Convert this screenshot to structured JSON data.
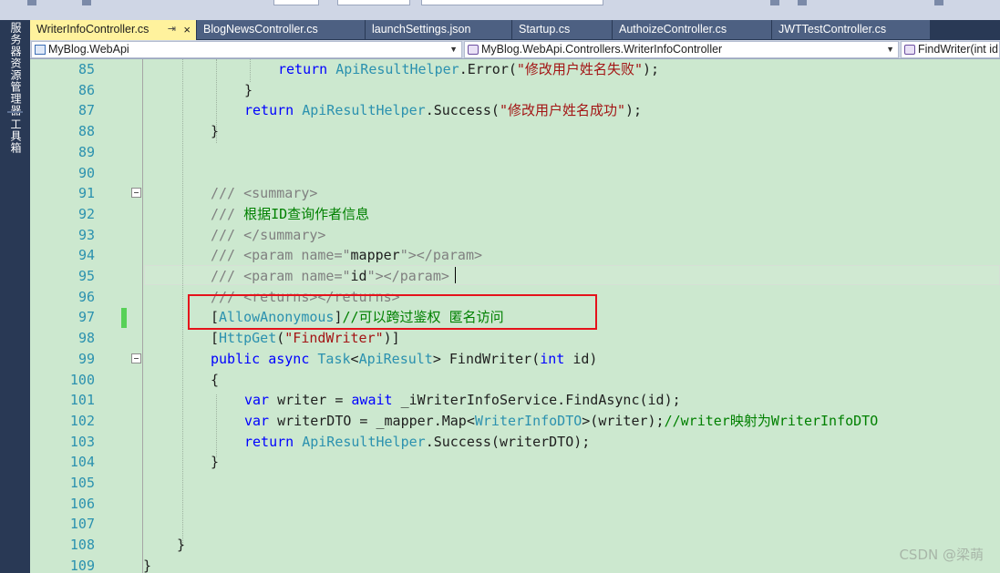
{
  "side_panel": {
    "items": [
      "服务器资源管理器",
      "工具箱"
    ]
  },
  "tabs": [
    {
      "label": "WriterInfoController.cs",
      "active": true,
      "pin": "⇥",
      "close": "×"
    },
    {
      "label": "BlogNewsController.cs",
      "active": false
    },
    {
      "label": "launchSettings.json",
      "active": false
    },
    {
      "label": "Startup.cs",
      "active": false
    },
    {
      "label": "AuthoizeController.cs",
      "active": false
    },
    {
      "label": "JWTTestController.cs",
      "active": false
    }
  ],
  "navbar": {
    "project": "MyBlog.WebApi",
    "class": "MyBlog.WebApi.Controllers.WriterInfoController",
    "member": "FindWriter(int id"
  },
  "editor": {
    "line_numbers": [
      "85",
      "86",
      "87",
      "88",
      "89",
      "90",
      "91",
      "92",
      "93",
      "94",
      "95",
      "96",
      "97",
      "98",
      "99",
      "100",
      "101",
      "102",
      "103",
      "104",
      "105",
      "106",
      "107",
      "108",
      "109"
    ],
    "lines": [
      [
        [
          "kw",
          "return"
        ],
        [
          "tx",
          " "
        ],
        [
          "ty",
          "ApiResultHelper"
        ],
        [
          "tx",
          ".Error("
        ],
        [
          "str",
          "\"修改用户姓名失败\""
        ],
        [
          "tx",
          ");"
        ]
      ],
      [
        [
          "tx",
          "}"
        ]
      ],
      [
        [
          "kw",
          "return"
        ],
        [
          "tx",
          " "
        ],
        [
          "ty",
          "ApiResultHelper"
        ],
        [
          "tx",
          ".Success("
        ],
        [
          "str",
          "\"修改用户姓名成功\""
        ],
        [
          "tx",
          ");"
        ]
      ],
      [
        [
          "tx",
          "}"
        ]
      ],
      [],
      [],
      [
        [
          "xml",
          "/// <summary>"
        ]
      ],
      [
        [
          "xml",
          "/// "
        ],
        [
          "cm",
          "根据ID查询作者信息"
        ]
      ],
      [
        [
          "xml",
          "/// </summary>"
        ]
      ],
      [
        [
          "xml",
          "/// <param name=\""
        ],
        [
          "nm",
          "mapper"
        ],
        [
          "xml",
          "\"></param>"
        ]
      ],
      [
        [
          "xml",
          "/// <param name=\""
        ],
        [
          "nm",
          "id"
        ],
        [
          "xml",
          "\"></param>"
        ]
      ],
      [
        [
          "xml",
          "/// <returns></returns>"
        ]
      ],
      [
        [
          "tx",
          "["
        ],
        [
          "ty",
          "AllowAnonymous"
        ],
        [
          "tx",
          "]"
        ],
        [
          "cm",
          "//可以跨过鉴权 匿名访问"
        ]
      ],
      [
        [
          "tx",
          "["
        ],
        [
          "ty",
          "HttpGet"
        ],
        [
          "tx",
          "("
        ],
        [
          "str",
          "\"FindWriter\""
        ],
        [
          "tx",
          ")]"
        ]
      ],
      [
        [
          "kw",
          "public"
        ],
        [
          "tx",
          " "
        ],
        [
          "kw",
          "async"
        ],
        [
          "tx",
          " "
        ],
        [
          "ty",
          "Task"
        ],
        [
          "tx",
          "<"
        ],
        [
          "ty",
          "ApiResult"
        ],
        [
          "tx",
          "> FindWriter("
        ],
        [
          "kw",
          "int"
        ],
        [
          "tx",
          " id)"
        ]
      ],
      [
        [
          "tx",
          "{"
        ]
      ],
      [
        [
          "kw",
          "var"
        ],
        [
          "tx",
          " writer = "
        ],
        [
          "kw",
          "await"
        ],
        [
          "tx",
          " _iWriterInfoService.FindAsync(id);"
        ]
      ],
      [
        [
          "kw",
          "var"
        ],
        [
          "tx",
          " writerDTO = _mapper.Map<"
        ],
        [
          "ty",
          "WriterInfoDTO"
        ],
        [
          "tx",
          ">(writer);"
        ],
        [
          "cm",
          "//writer映射为WriterInfoDTO"
        ]
      ],
      [
        [
          "kw",
          "return"
        ],
        [
          "tx",
          " "
        ],
        [
          "ty",
          "ApiResultHelper"
        ],
        [
          "tx",
          ".Success(writerDTO);"
        ]
      ],
      [
        [
          "tx",
          "}"
        ]
      ],
      [],
      [],
      [],
      [
        [
          "tx",
          "}"
        ]
      ],
      [
        [
          "tx",
          "}"
        ]
      ]
    ],
    "indents": [
      272,
      235,
      235,
      198,
      0,
      0,
      198,
      198,
      198,
      198,
      198,
      198,
      198,
      198,
      198,
      198,
      235,
      235,
      235,
      198,
      0,
      0,
      0,
      161,
      124
    ]
  },
  "watermark": "CSDN @梁萌"
}
